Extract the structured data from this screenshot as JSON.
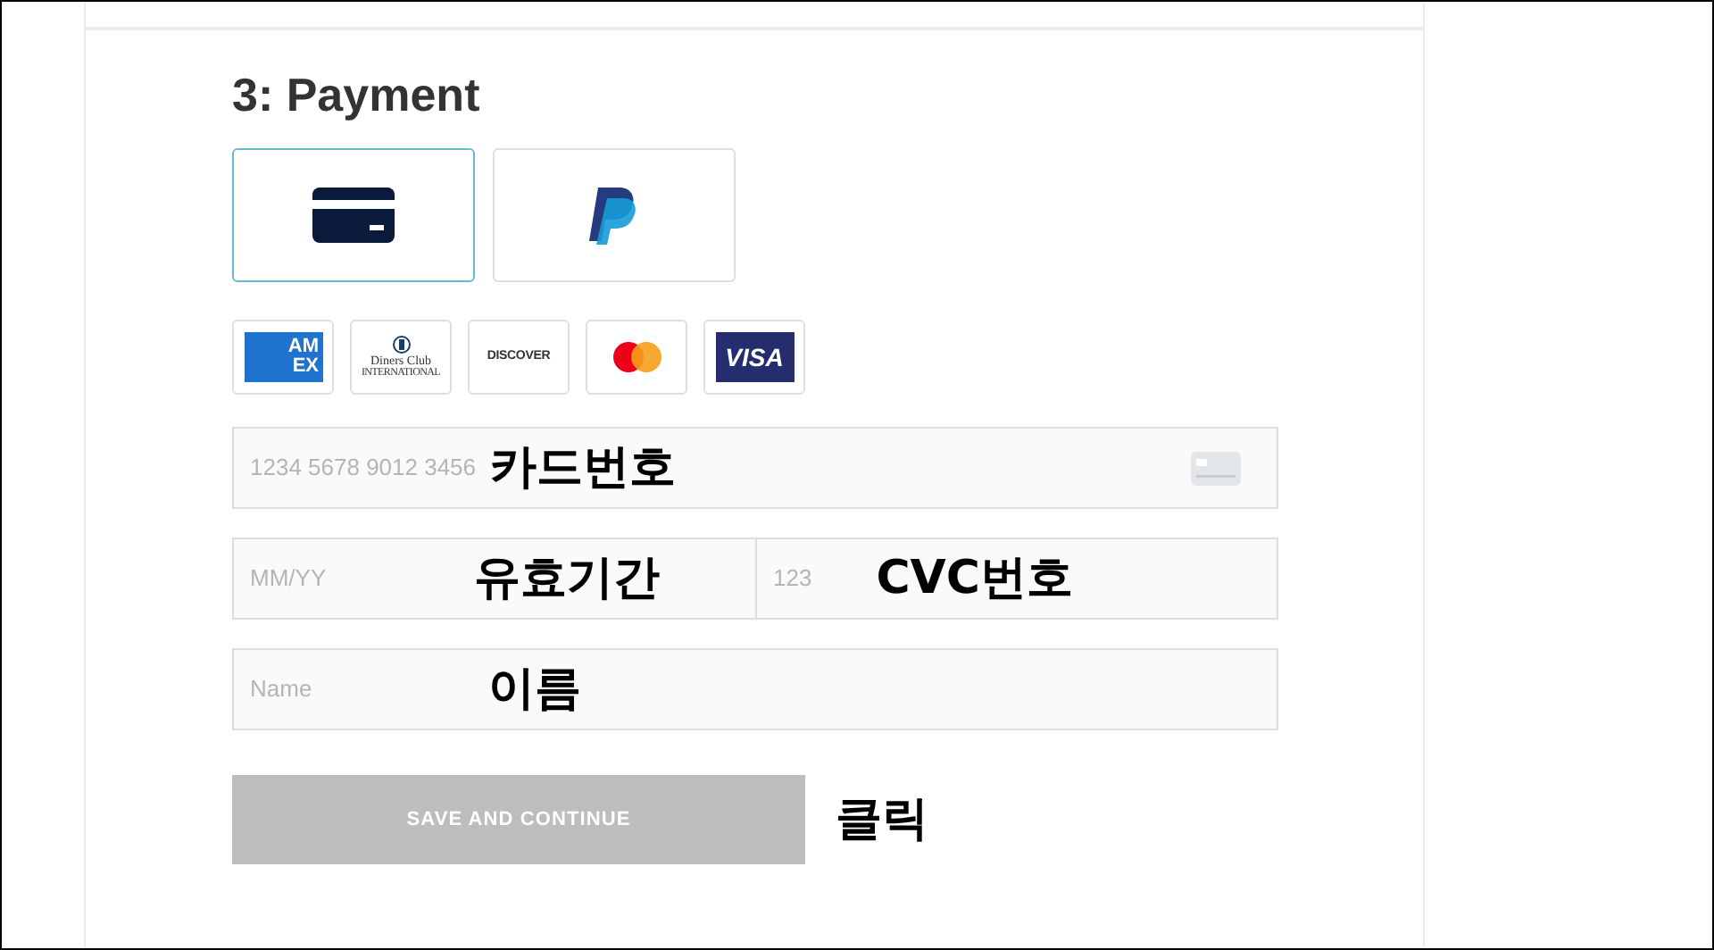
{
  "section_title": "3: Payment",
  "payment_methods": [
    {
      "kind": "card",
      "selected": true
    },
    {
      "kind": "paypal",
      "selected": false
    }
  ],
  "card_brands": [
    {
      "kind": "amex",
      "label": "AM EX"
    },
    {
      "kind": "diners",
      "label": "Diners Club",
      "sublabel": "INTERNATIONAL"
    },
    {
      "kind": "discover",
      "label": "DISCOVER"
    },
    {
      "kind": "mastercard"
    },
    {
      "kind": "visa",
      "label": "VISA"
    }
  ],
  "card_number": {
    "placeholder": "1234 5678 9012 3456",
    "annotation": "카드번호"
  },
  "expiry": {
    "placeholder": "MM/YY",
    "annotation": "유효기간"
  },
  "cvc": {
    "placeholder": "123",
    "annotation": "CVC번호"
  },
  "name": {
    "placeholder": "Name",
    "annotation": "이름"
  },
  "save_button": {
    "label": "SAVE AND CONTINUE",
    "disabled": true
  },
  "button_annotation": "클릭"
}
